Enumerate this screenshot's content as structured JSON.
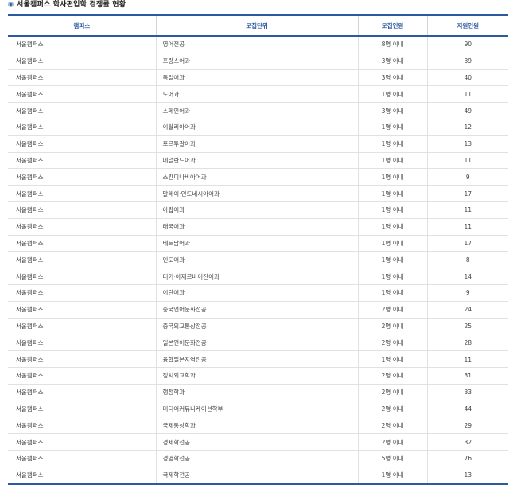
{
  "title": "서울캠퍼스 학사편입학 경쟁률 현황",
  "table": {
    "headers": [
      "캠퍼스",
      "모집단위",
      "모집인원",
      "지원인원"
    ],
    "rows": [
      [
        "서울캠퍼스",
        "영어전공",
        "8명 이내",
        "90"
      ],
      [
        "서울캠퍼스",
        "프랑스어과",
        "3명 이내",
        "39"
      ],
      [
        "서울캠퍼스",
        "독일어과",
        "3명 이내",
        "40"
      ],
      [
        "서울캠퍼스",
        "노어과",
        "1명 이내",
        "11"
      ],
      [
        "서울캠퍼스",
        "스페인어과",
        "3명 이내",
        "49"
      ],
      [
        "서울캠퍼스",
        "이탈리아어과",
        "1명 이내",
        "12"
      ],
      [
        "서울캠퍼스",
        "포르투갈어과",
        "1명 이내",
        "13"
      ],
      [
        "서울캠퍼스",
        "네덜란드어과",
        "1명 이내",
        "11"
      ],
      [
        "서울캠퍼스",
        "스칸디나비아어과",
        "1명 이내",
        "9"
      ],
      [
        "서울캠퍼스",
        "말레이·인도네시아어과",
        "1명 이내",
        "17"
      ],
      [
        "서울캠퍼스",
        "아랍어과",
        "1명 이내",
        "11"
      ],
      [
        "서울캠퍼스",
        "태국어과",
        "1명 이내",
        "11"
      ],
      [
        "서울캠퍼스",
        "베트남어과",
        "1명 이내",
        "17"
      ],
      [
        "서울캠퍼스",
        "인도어과",
        "1명 이내",
        "8"
      ],
      [
        "서울캠퍼스",
        "터키·아제르바이잔어과",
        "1명 이내",
        "14"
      ],
      [
        "서울캠퍼스",
        "이란어과",
        "1명 이내",
        "9"
      ],
      [
        "서울캠퍼스",
        "중국언어문화전공",
        "2명 이내",
        "24"
      ],
      [
        "서울캠퍼스",
        "중국외교통상전공",
        "2명 이내",
        "25"
      ],
      [
        "서울캠퍼스",
        "일본언어문화전공",
        "2명 이내",
        "28"
      ],
      [
        "서울캠퍼스",
        "융합일본지역전공",
        "1명 이내",
        "11"
      ],
      [
        "서울캠퍼스",
        "정치외교학과",
        "2명 이내",
        "31"
      ],
      [
        "서울캠퍼스",
        "행정학과",
        "2명 이내",
        "33"
      ],
      [
        "서울캠퍼스",
        "미디어커뮤니케이션학부",
        "2명 이내",
        "44"
      ],
      [
        "서울캠퍼스",
        "국제통상학과",
        "2명 이내",
        "29"
      ],
      [
        "서울캠퍼스",
        "경제학전공",
        "2명 이내",
        "32"
      ],
      [
        "서울캠퍼스",
        "경영학전공",
        "5명 이내",
        "76"
      ],
      [
        "서울캠퍼스",
        "국제학전공",
        "1명 이내",
        "13"
      ]
    ]
  }
}
